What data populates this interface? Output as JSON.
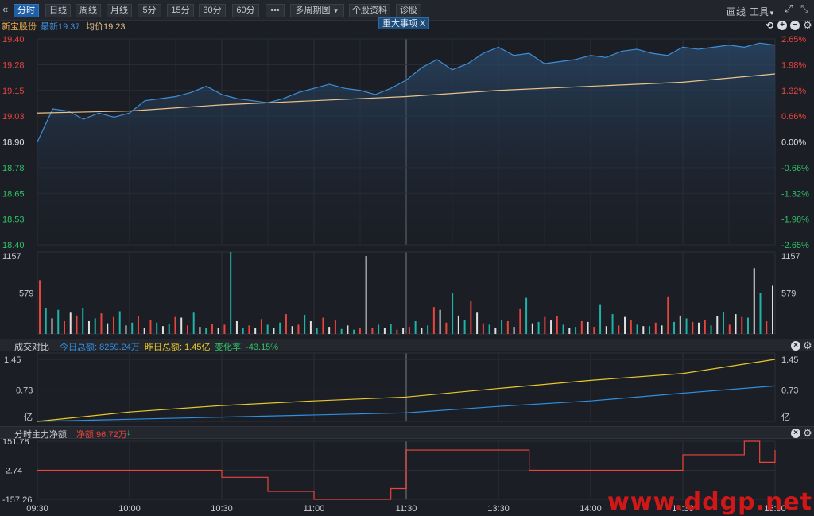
{
  "toolbar": {
    "collapse_icon": "double-chevron-left-icon",
    "tabs": [
      "分时",
      "日线",
      "周线",
      "月线",
      "5分",
      "15分",
      "30分",
      "60分"
    ],
    "more_label": "•••",
    "multi_period_label": "多周期图",
    "stock_info_label": "个股资料",
    "diagnose_label": "诊股",
    "draw_label": "画线",
    "tools_label": "工具",
    "fullscreen_icon": "expand-icon",
    "minimize_icon": "minimize-icon"
  },
  "price_header": {
    "stock_name": "新宝股份",
    "latest_label": "最新19.37",
    "avg_label": "均价19.23",
    "event_tag": "重大事项  X"
  },
  "price_axis": {
    "left": [
      "19.40",
      "19.28",
      "19.15",
      "19.03",
      "18.90",
      "18.78",
      "18.65",
      "18.53",
      "18.40"
    ],
    "right": [
      "2.65%",
      "1.98%",
      "1.32%",
      "0.66%",
      "0.00%",
      "-0.66%",
      "-1.32%",
      "-1.98%",
      "-2.65%"
    ]
  },
  "volume_axis": {
    "top": "1157",
    "mid": "579"
  },
  "turnover_header": {
    "title": "成交对比",
    "today": "今日总额: 8259.24万",
    "yesterday": "昨日总额: 1.45亿",
    "change": "变化率: -43.15%"
  },
  "turnover_axis": {
    "top": "1.45",
    "mid": "0.73",
    "unit": "亿"
  },
  "flow_header": {
    "title": "分时主力净额:",
    "net": "净额:96.72万",
    "arrow": "↓"
  },
  "flow_axis": {
    "top": "151.78",
    "mid": "-2.74",
    "bottom": "-157.26"
  },
  "time_axis": [
    "09:30",
    "10:00",
    "10:30",
    "11:00",
    "11:30",
    "13:30",
    "14:00",
    "14:30",
    "15:00"
  ],
  "watermark": "www.ddgp.net",
  "colors": {
    "up": "#e8453c",
    "down": "#1fb2a6",
    "price_line": "#3e8ed8",
    "avg_line": "#e8c28a",
    "today_line": "#2f8fe0",
    "yesterday_line": "#e8c92a",
    "flow_line": "#e8453c"
  },
  "chart_data": [
    {
      "type": "line",
      "title": "",
      "series": [
        {
          "name": "最新",
          "x": [
            "09:30",
            "09:35",
            "09:40",
            "09:45",
            "09:50",
            "09:55",
            "10:00",
            "10:05",
            "10:10",
            "10:15",
            "10:20",
            "10:25",
            "10:30",
            "10:35",
            "10:40",
            "10:45",
            "10:50",
            "10:55",
            "11:00",
            "11:05",
            "11:10",
            "11:15",
            "11:20",
            "11:25",
            "11:30",
            "13:05",
            "13:10",
            "13:15",
            "13:20",
            "13:25",
            "13:30",
            "13:35",
            "13:40",
            "13:45",
            "13:50",
            "13:55",
            "14:00",
            "14:05",
            "14:10",
            "14:15",
            "14:20",
            "14:25",
            "14:30",
            "14:35",
            "14:40",
            "14:45",
            "14:50",
            "14:55",
            "15:00"
          ],
          "values": [
            18.9,
            19.06,
            19.05,
            19.01,
            19.04,
            19.02,
            19.04,
            19.1,
            19.11,
            19.12,
            19.14,
            19.17,
            19.13,
            19.11,
            19.1,
            19.09,
            19.11,
            19.14,
            19.16,
            19.18,
            19.16,
            19.15,
            19.13,
            19.16,
            19.2,
            19.26,
            19.3,
            19.25,
            19.28,
            19.33,
            19.36,
            19.32,
            19.33,
            19.28,
            19.29,
            19.3,
            19.32,
            19.31,
            19.34,
            19.35,
            19.33,
            19.32,
            19.36,
            19.35,
            19.36,
            19.37,
            19.36,
            19.38,
            19.37
          ]
        },
        {
          "name": "均价",
          "x": [
            "09:30",
            "10:00",
            "10:30",
            "11:00",
            "11:30",
            "13:30",
            "14:00",
            "14:30",
            "15:00"
          ],
          "values": [
            19.04,
            19.05,
            19.08,
            19.1,
            19.12,
            19.15,
            19.17,
            19.19,
            19.23
          ]
        }
      ],
      "ylim": [
        18.4,
        19.4
      ],
      "y2_labels": [
        "2.65%",
        "1.98%",
        "1.32%",
        "0.66%",
        "0.00%",
        "-0.66%",
        "-1.32%",
        "-1.98%",
        "-2.65%"
      ]
    },
    {
      "type": "bar",
      "title": "",
      "x_range": [
        "09:30",
        "15:00"
      ],
      "bar_count": 120,
      "values": [
        760,
        360,
        220,
        340,
        180,
        300,
        260,
        360,
        180,
        220,
        290,
        150,
        240,
        320,
        120,
        160,
        250,
        90,
        200,
        160,
        110,
        140,
        240,
        230,
        120,
        300,
        100,
        80,
        140,
        90,
        130,
        1157,
        180,
        90,
        120,
        80,
        210,
        130,
        90,
        160,
        280,
        110,
        130,
        270,
        180,
        90,
        230,
        100,
        190,
        70,
        120,
        60,
        90,
        1100,
        90,
        130,
        80,
        140,
        60,
        90,
        100,
        180,
        80,
        120,
        380,
        340,
        160,
        580,
        260,
        200,
        460,
        300,
        150,
        130,
        90,
        200,
        180,
        100,
        350,
        510,
        150,
        170,
        240,
        190,
        250,
        130,
        90,
        100,
        180,
        170,
        100,
        420,
        110,
        280,
        120,
        240,
        190,
        130,
        110,
        110,
        160,
        120,
        530,
        170,
        260,
        220,
        170,
        160,
        200,
        120,
        250,
        310,
        130,
        280,
        240,
        230,
        930,
        580,
        180,
        680
      ],
      "colors": [
        "#e8453c",
        "#1fb2a6",
        "#e0e0e0"
      ],
      "ylim": [
        0,
        1157
      ]
    },
    {
      "type": "line",
      "title": "成交对比",
      "series": [
        {
          "name": "今日总额",
          "x": [
            "09:30",
            "10:00",
            "10:30",
            "11:00",
            "11:30",
            "13:30",
            "14:00",
            "14:30",
            "15:00"
          ],
          "values": [
            0.0,
            0.05,
            0.1,
            0.15,
            0.2,
            0.35,
            0.48,
            0.66,
            0.83
          ]
        },
        {
          "name": "昨日总额",
          "x": [
            "09:30",
            "10:00",
            "10:30",
            "11:00",
            "11:30",
            "13:30",
            "14:00",
            "14:30",
            "15:00"
          ],
          "values": [
            0.0,
            0.22,
            0.37,
            0.48,
            0.57,
            0.77,
            0.96,
            1.12,
            1.45
          ]
        }
      ],
      "ylim": [
        0,
        1.45
      ]
    },
    {
      "type": "line",
      "title": "分时主力净额",
      "series": [
        {
          "name": "净额",
          "x": [
            "09:30",
            "10:00",
            "10:20",
            "10:30",
            "10:45",
            "11:00",
            "11:10",
            "11:25",
            "11:30",
            "13:30",
            "13:40",
            "14:00",
            "14:20",
            "14:30",
            "14:40",
            "14:50",
            "14:55",
            "15:00"
          ],
          "values": [
            -2.74,
            -2.74,
            -2.74,
            -40,
            -115,
            -157.26,
            -157.26,
            -100,
            105,
            105,
            -2.74,
            -2.74,
            -2.74,
            80,
            80,
            151.78,
            40,
            105
          ]
        }
      ],
      "ylim": [
        -157.26,
        151.78
      ]
    }
  ]
}
